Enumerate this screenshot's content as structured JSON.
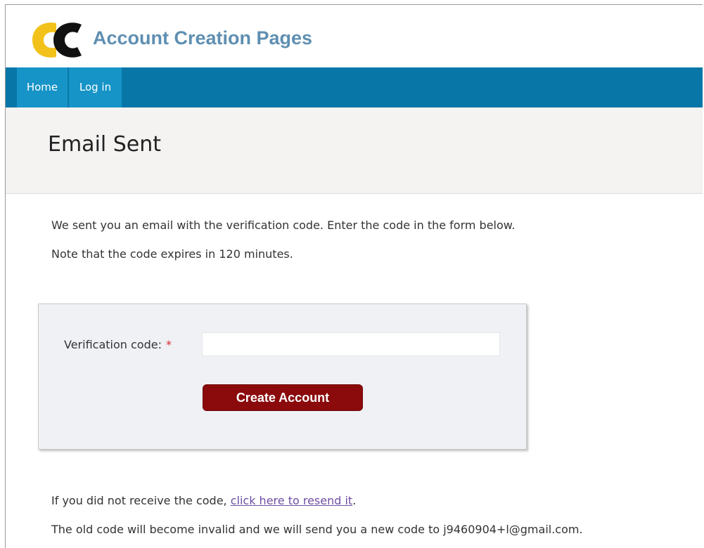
{
  "header": {
    "logo_icon": "ec-logo",
    "site_title": "Account Creation Pages"
  },
  "nav": {
    "items": [
      {
        "label": "Home"
      },
      {
        "label": "Log in"
      }
    ]
  },
  "page": {
    "title": "Email Sent",
    "intro_line1": "We sent you an email with the verification code. Enter the code in the form below.",
    "intro_line2": "Note that the code expires in 120 minutes."
  },
  "form": {
    "code_label": "Verification code:",
    "required_mark": "*",
    "code_value": "",
    "code_placeholder": "",
    "submit_label": "Create Account"
  },
  "footer_text": {
    "resend_prefix": "If you did not receive the code, ",
    "resend_link": "click here to resend it",
    "resend_suffix": ".",
    "invalid_notice": "The old code will become invalid and we will send you a new code to j9460904+l@gmail.com."
  },
  "colors": {
    "nav_bar": "#0876a7",
    "nav_item": "#1694c8",
    "site_title": "#5f8fb1",
    "button": "#8b0a0c",
    "logo_yellow": "#f2c21a",
    "logo_black": "#111111"
  }
}
